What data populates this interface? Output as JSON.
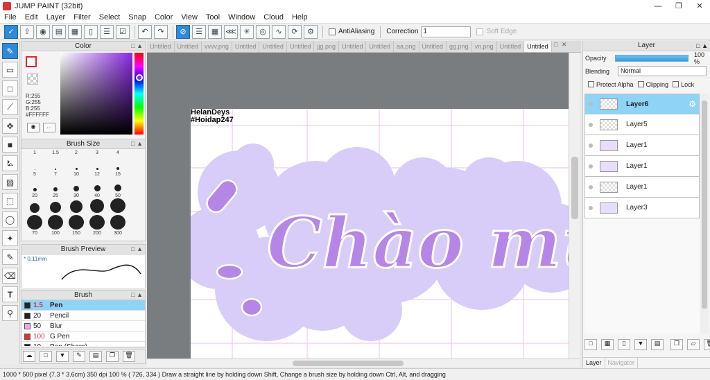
{
  "window": {
    "title": "JUMP PAINT (32bit)"
  },
  "menu": [
    "File",
    "Edit",
    "Layer",
    "Filter",
    "Select",
    "Snap",
    "Color",
    "View",
    "Tool",
    "Window",
    "Cloud",
    "Help"
  ],
  "toolbar": {
    "antialias_label": "AntiAliasing",
    "correction_label": "Correction",
    "correction_value": "1",
    "soft_edge_label": "Soft Edge"
  },
  "color_panel": {
    "title": "Color",
    "r": "R:255",
    "g": "G:255",
    "b": "B:255",
    "hex": "#FFFFFF"
  },
  "brush_size_panel": {
    "title": "Brush Size",
    "sizes": [
      {
        "label": "1",
        "d": 1
      },
      {
        "label": "1.5",
        "d": 2
      },
      {
        "label": "2",
        "d": 3
      },
      {
        "label": "3",
        "d": 3
      },
      {
        "label": "4",
        "d": 4
      },
      {
        "label": "5",
        "d": 5
      },
      {
        "label": "7",
        "d": 6
      },
      {
        "label": "10",
        "d": 8
      },
      {
        "label": "12",
        "d": 9
      },
      {
        "label": "15",
        "d": 10
      },
      {
        "label": "20",
        "d": 14
      },
      {
        "label": "25",
        "d": 16
      },
      {
        "label": "30",
        "d": 18
      },
      {
        "label": "40",
        "d": 20
      },
      {
        "label": "50",
        "d": 22
      },
      {
        "label": "70",
        "d": 22
      },
      {
        "label": "100",
        "d": 22
      },
      {
        "label": "150",
        "d": 22
      },
      {
        "label": "200",
        "d": 22
      },
      {
        "label": "300",
        "d": 22
      }
    ]
  },
  "brush_preview": {
    "title": "Brush Preview",
    "size_label": "0.11mm"
  },
  "brush_panel": {
    "title": "Brush",
    "items": [
      {
        "size": "1.5",
        "name": "Pen",
        "color": "#222222",
        "selected": true,
        "red": true
      },
      {
        "size": "20",
        "name": "Pencil",
        "color": "#222222",
        "selected": false,
        "red": false
      },
      {
        "size": "50",
        "name": "Blur",
        "color": "#f2a3f2",
        "selected": false,
        "red": false
      },
      {
        "size": "100",
        "name": "G Pen",
        "color": "#e03030",
        "selected": false,
        "red": true
      },
      {
        "size": "10",
        "name": "Pen (Sharp)",
        "color": "#222222",
        "selected": false,
        "red": false
      }
    ]
  },
  "tabs": [
    "Untitled",
    "Untitled",
    "vvvv.png",
    "Untitled",
    "Untitled",
    "Untitled",
    "jjg.png",
    "Untitled",
    "Untitled",
    "aa.png",
    "Untitled",
    "gg.png",
    "vn.png",
    "Untitled",
    "Untitled"
  ],
  "active_tab_index": 14,
  "canvas": {
    "watermark_line1": "HelanDeys",
    "watermark_line2": "#Hoidap247",
    "artwork_text": "Chào mừ"
  },
  "layer_panel": {
    "title": "Layer",
    "opacity_label": "Opacity",
    "opacity_value": "100 %",
    "opacity": 1.0,
    "blending_label": "Blending",
    "blending_value": "Normal",
    "protect_alpha_label": "Protect Alpha",
    "clipping_label": "Clipping",
    "lock_label": "Lock",
    "layers": [
      {
        "name": "Layer6",
        "selected": true,
        "thumb": "empty"
      },
      {
        "name": "Layer5",
        "selected": false,
        "thumb": "empty"
      },
      {
        "name": "Layer1",
        "selected": false,
        "thumb": "purple"
      },
      {
        "name": "Layer1",
        "selected": false,
        "thumb": "purple"
      },
      {
        "name": "Layer1",
        "selected": false,
        "thumb": "empty"
      },
      {
        "name": "Layer3",
        "selected": false,
        "thumb": "purple"
      }
    ],
    "tab_layer": "Layer",
    "tab_navigator": "Navigator"
  },
  "status": {
    "text": "1000 * 500 pixel   (7.3 * 3.6cm)   350 dpi   100 %   ( 726, 334 )   Draw a straight line by holding down Shift, Change a brush size by holding down Ctrl, Alt, and dragging"
  },
  "colors": {
    "accent": "#2f8bd8",
    "selected_row": "#8fd3f7",
    "blob": "#d8cdf8",
    "letter": "#b586e6",
    "grid": "#f3c7f0"
  }
}
